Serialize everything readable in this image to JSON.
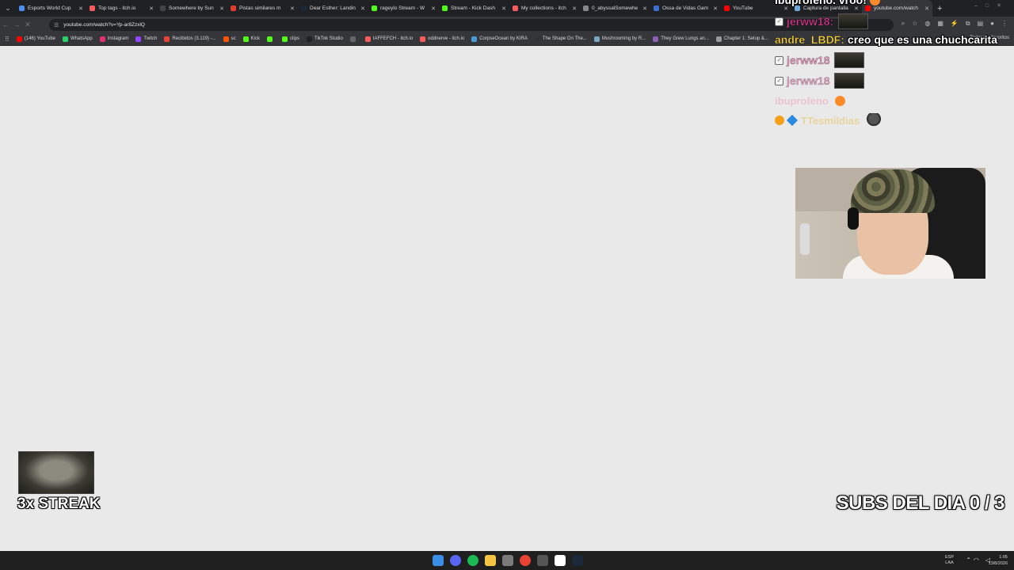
{
  "browser": {
    "tabs": [
      {
        "label": "Esports World Cup",
        "color": "#4a8ef0"
      },
      {
        "label": "Top tags - itch.io",
        "color": "#fa5c5c"
      },
      {
        "label": "Somewhere by Sun",
        "color": "#444444"
      },
      {
        "label": "Pistas similares m",
        "color": "#e43b2b"
      },
      {
        "label": "Dear Esther: Landin",
        "color": "#1b2838"
      },
      {
        "label": "rageylo Stream - W",
        "color": "#53fc18"
      },
      {
        "label": "Stream - Kick Dash",
        "color": "#53fc18"
      },
      {
        "label": "My collections - itch",
        "color": "#fa5c5c"
      },
      {
        "label": "0_abyssalSomewhe",
        "color": "#888888"
      },
      {
        "label": "Ossa de Vidas Gam",
        "color": "#3b6fd1"
      },
      {
        "label": "YouTube",
        "color": "#ff0000"
      },
      {
        "label": "Captura de pantalla",
        "color": "#6fa8dc"
      },
      {
        "label": "youtube.com/watch",
        "color": "#ff0000"
      }
    ],
    "url": "youtube.com/watch?v=Yp-ar8ZzxlQ",
    "bookmarks": [
      {
        "label": "(146) YouTube",
        "color": "#ff0000"
      },
      {
        "label": "WhatsApp",
        "color": "#25d366"
      },
      {
        "label": "Instagram",
        "color": "#e1306c"
      },
      {
        "label": "Twitch",
        "color": "#9146ff"
      },
      {
        "label": "Recibidos (3.119) -...",
        "color": "#ea4335"
      },
      {
        "label": "sc",
        "color": "#ff5500"
      },
      {
        "label": "Kick",
        "color": "#53fc18"
      },
      {
        "label": "",
        "color": "#53fc18"
      },
      {
        "label": "clips",
        "color": "#53fc18"
      },
      {
        "label": "TikTok Studio",
        "color": "#222222"
      },
      {
        "label": "",
        "color": "#666666"
      },
      {
        "label": "IAFFEFCH - itch.io",
        "color": "#fa5c5c"
      },
      {
        "label": "oddnerve - itch.io",
        "color": "#fa5c5c"
      },
      {
        "label": "CorpseOcean by KIRA",
        "color": "#4a9bd6"
      },
      {
        "label": "The Shape On The...",
        "color": "#333333"
      },
      {
        "label": "Mushrooming by R...",
        "color": "#7aa6c2"
      },
      {
        "label": "They Grew Lungs an...",
        "color": "#8a5fb5"
      },
      {
        "label": "Chapter 1: Setup &...",
        "color": "#999999"
      }
    ],
    "bookmarks_right": "Todos los favoritos"
  },
  "chat": {
    "top_partial": {
      "user": "ibuprofeno",
      "text": "vroo!"
    },
    "messages": [
      {
        "user": "jerww18:",
        "user_color": "#d63a8c",
        "text": ""
      },
      {
        "user": "andre_LBDF:",
        "user_color": "#f7d240",
        "text": "creo que es una chuchcarita"
      },
      {
        "user": "jerww18",
        "user_color": "#d63a8c",
        "text": ""
      },
      {
        "user": "jerww18",
        "user_color": "#d63a8c",
        "text": ""
      },
      {
        "user": "ibuprofeno",
        "user_color": "#f2a3c1",
        "text": ""
      },
      {
        "user": "TTesmildias",
        "user_color": "#e8c76a",
        "text": ""
      }
    ]
  },
  "overlay": {
    "streak": "3x STREAK",
    "subs": "SUBS DEL DIA 0 / 3"
  },
  "taskbar": {
    "apps": [
      {
        "name": "windows-start",
        "color": "#3a8ee6"
      },
      {
        "name": "discord",
        "color": "#5865f2"
      },
      {
        "name": "spotify",
        "color": "#1db954"
      },
      {
        "name": "file-explorer",
        "color": "#f4c542"
      },
      {
        "name": "app",
        "color": "#7a7a7a"
      },
      {
        "name": "chrome",
        "color": "#e94235"
      },
      {
        "name": "obs",
        "color": "#555555"
      },
      {
        "name": "capcut",
        "color": "#ffffff"
      },
      {
        "name": "steam",
        "color": "#1b2838"
      }
    ],
    "lang": [
      "ESP",
      "LAA"
    ],
    "time": "1:05",
    "date": "13/8/2026"
  }
}
